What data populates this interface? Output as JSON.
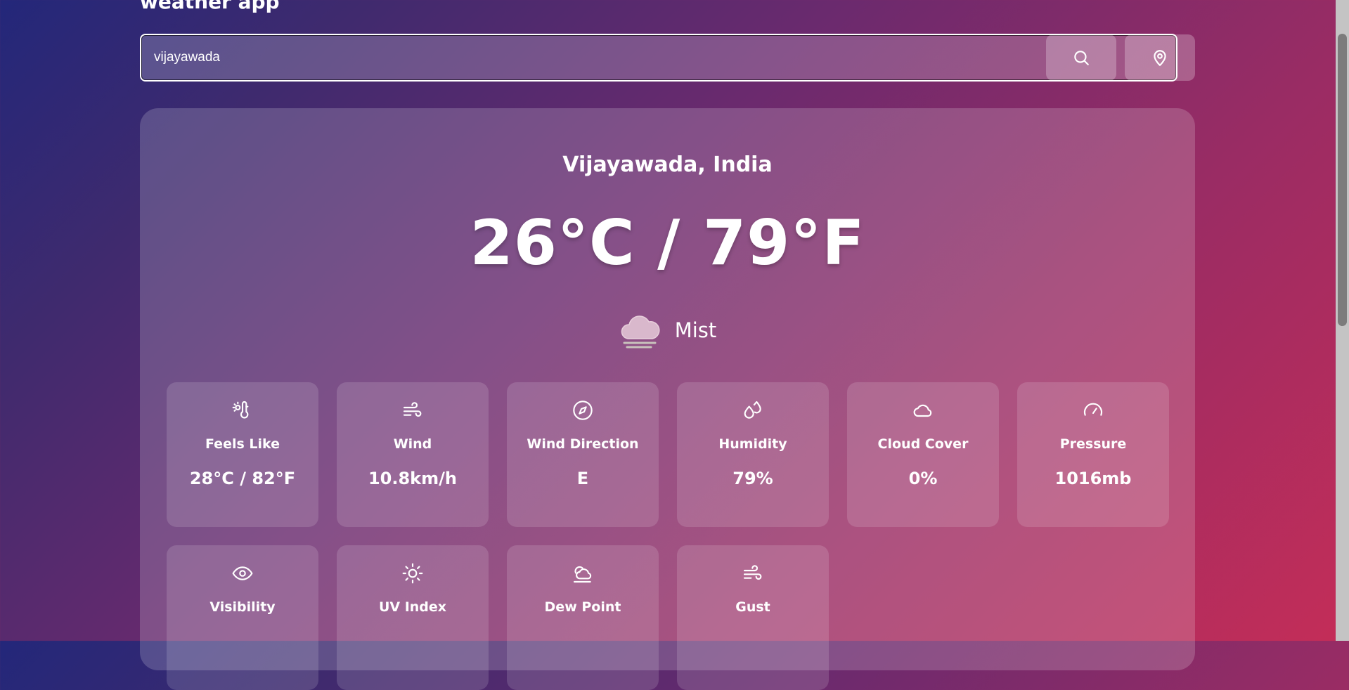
{
  "app": {
    "title": "weather app"
  },
  "search": {
    "value": "vijayawada"
  },
  "weather": {
    "location": "Vijayawada, India",
    "temperature": "26°C / 79°F",
    "condition": "Mist",
    "condition_icon": "mist-cloud-icon"
  },
  "details": [
    {
      "label": "Feels Like",
      "value": "28°C / 82°F",
      "icon": "thermometer-sun-icon"
    },
    {
      "label": "Wind",
      "value": "10.8km/h",
      "icon": "wind-icon"
    },
    {
      "label": "Wind Direction",
      "value": "E",
      "icon": "compass-icon"
    },
    {
      "label": "Humidity",
      "value": "79%",
      "icon": "droplets-icon"
    },
    {
      "label": "Cloud Cover",
      "value": "0%",
      "icon": "cloud-icon"
    },
    {
      "label": "Pressure",
      "value": "1016mb",
      "icon": "gauge-icon"
    },
    {
      "label": "Visibility",
      "icon": "eye-icon"
    },
    {
      "label": "UV Index",
      "icon": "sun-icon"
    },
    {
      "label": "Dew Point",
      "icon": "cloud-sun-icon"
    },
    {
      "label": "Gust",
      "icon": "wind-icon"
    }
  ]
}
